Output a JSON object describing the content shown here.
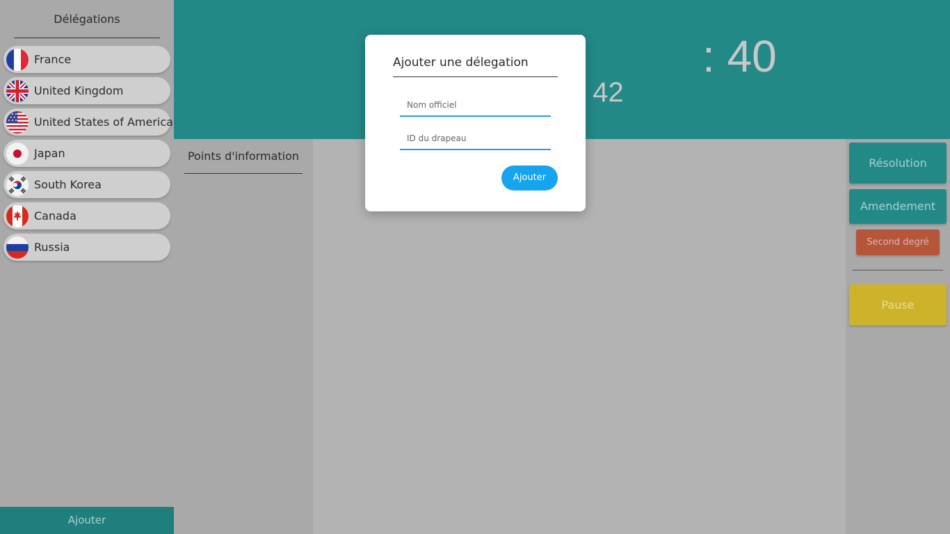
{
  "sidebar": {
    "title": "Délégations",
    "add_label": "Ajouter",
    "delegations": [
      {
        "name": "France",
        "flag": "france-flag"
      },
      {
        "name": "United Kingdom",
        "flag": "uk-flag"
      },
      {
        "name": "United States of America",
        "flag": "usa-flag"
      },
      {
        "name": "Japan",
        "flag": "japan-flag"
      },
      {
        "name": "South Korea",
        "flag": "south-korea-flag"
      },
      {
        "name": "Canada",
        "flag": "canada-flag"
      },
      {
        "name": "Russia",
        "flag": "russia-flag"
      }
    ]
  },
  "timers": {
    "main": ": 40",
    "sub": ": 42"
  },
  "points_panel": {
    "title": "Points d'information"
  },
  "right_panel": {
    "resolution_label": "Résolution",
    "amendement_label": "Amendement",
    "second_degre_label": "Second degré",
    "pause_label": "Pause"
  },
  "modal": {
    "title": "Ajouter une délegation",
    "field_nom_placeholder": "Nom officiel",
    "field_drapeau_placeholder": "ID du drapeau",
    "submit_label": "Ajouter"
  },
  "colors": {
    "teal": "#238987",
    "sidebar_bg": "#a9a9a9",
    "content_bg": "#b3b3b3",
    "second_degre": "#b5553a",
    "pause": "#cdb32a",
    "modal_accent": "#16a4ee"
  }
}
